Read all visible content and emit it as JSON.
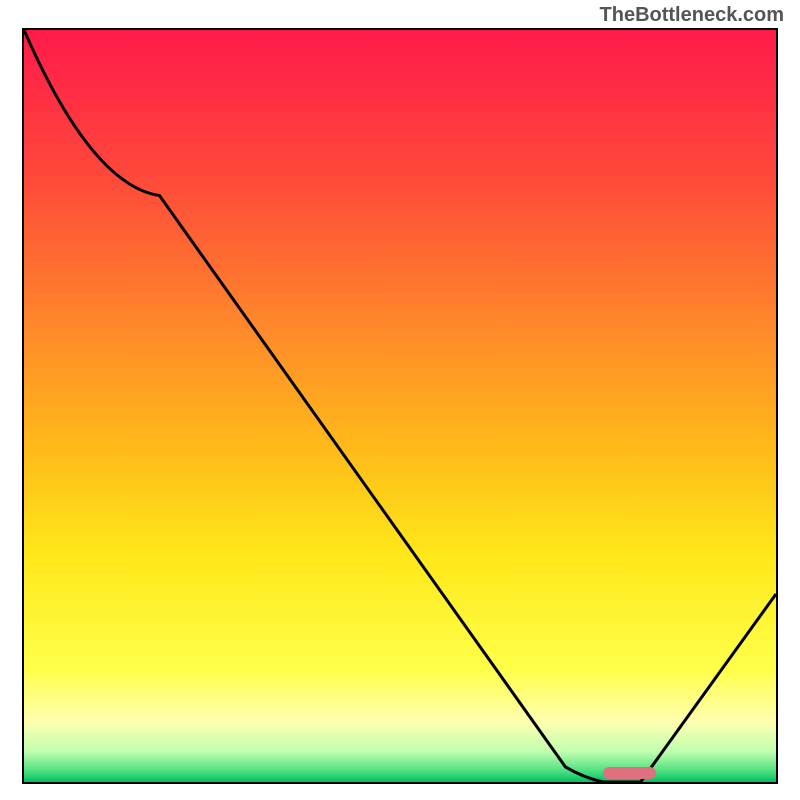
{
  "watermark": "TheBottleneck.com",
  "chart_data": {
    "type": "line",
    "x": [
      0.0,
      0.18,
      0.72,
      0.77,
      0.82,
      1.0
    ],
    "y": [
      1.0,
      0.78,
      0.02,
      0.0,
      0.0,
      0.25
    ],
    "xlim": [
      0,
      1
    ],
    "ylim": [
      0,
      1
    ],
    "marker": {
      "x_start": 0.77,
      "x_end": 0.84,
      "y": 0.012
    },
    "title": "",
    "xlabel": "",
    "ylabel": ""
  },
  "colors": {
    "top": "#ff1a4a",
    "mid": "#ffe81a",
    "bottom_green": "#00c060",
    "marker": "#e07080",
    "line": "#000000"
  }
}
